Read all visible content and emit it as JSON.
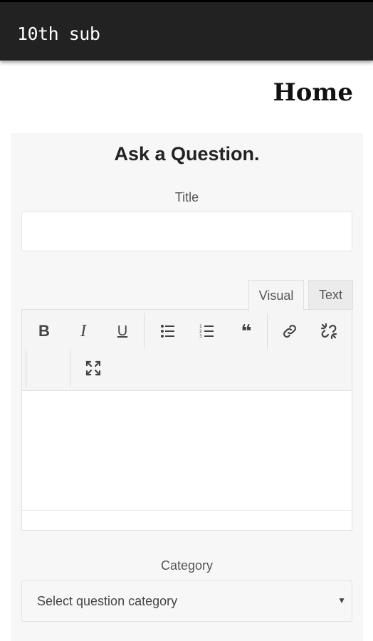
{
  "app": {
    "title": "10th sub"
  },
  "page": {
    "heading": "Home"
  },
  "form": {
    "title": "Ask a Question.",
    "title_label": "Title",
    "title_value": "",
    "editor_tabs": [
      {
        "label": "Visual",
        "active": true
      },
      {
        "label": "Text",
        "active": false
      }
    ],
    "toolbar": [
      {
        "name": "bold-icon",
        "glyph": "B"
      },
      {
        "name": "italic-icon",
        "glyph": "I"
      },
      {
        "name": "underline-icon",
        "glyph": "U"
      },
      {
        "name": "bulleted-list-icon"
      },
      {
        "name": "numbered-list-icon"
      },
      {
        "name": "blockquote-icon",
        "glyph": "❝"
      },
      {
        "name": "insert-link-icon"
      },
      {
        "name": "remove-link-icon"
      },
      {
        "name": "fullscreen-icon"
      }
    ],
    "category_label": "Category",
    "category_select": {
      "selected": "Select question category"
    }
  },
  "colors": {
    "appbar": "#222222",
    "card": "#f7f7f7",
    "toolbar": "#f5f5f5"
  }
}
